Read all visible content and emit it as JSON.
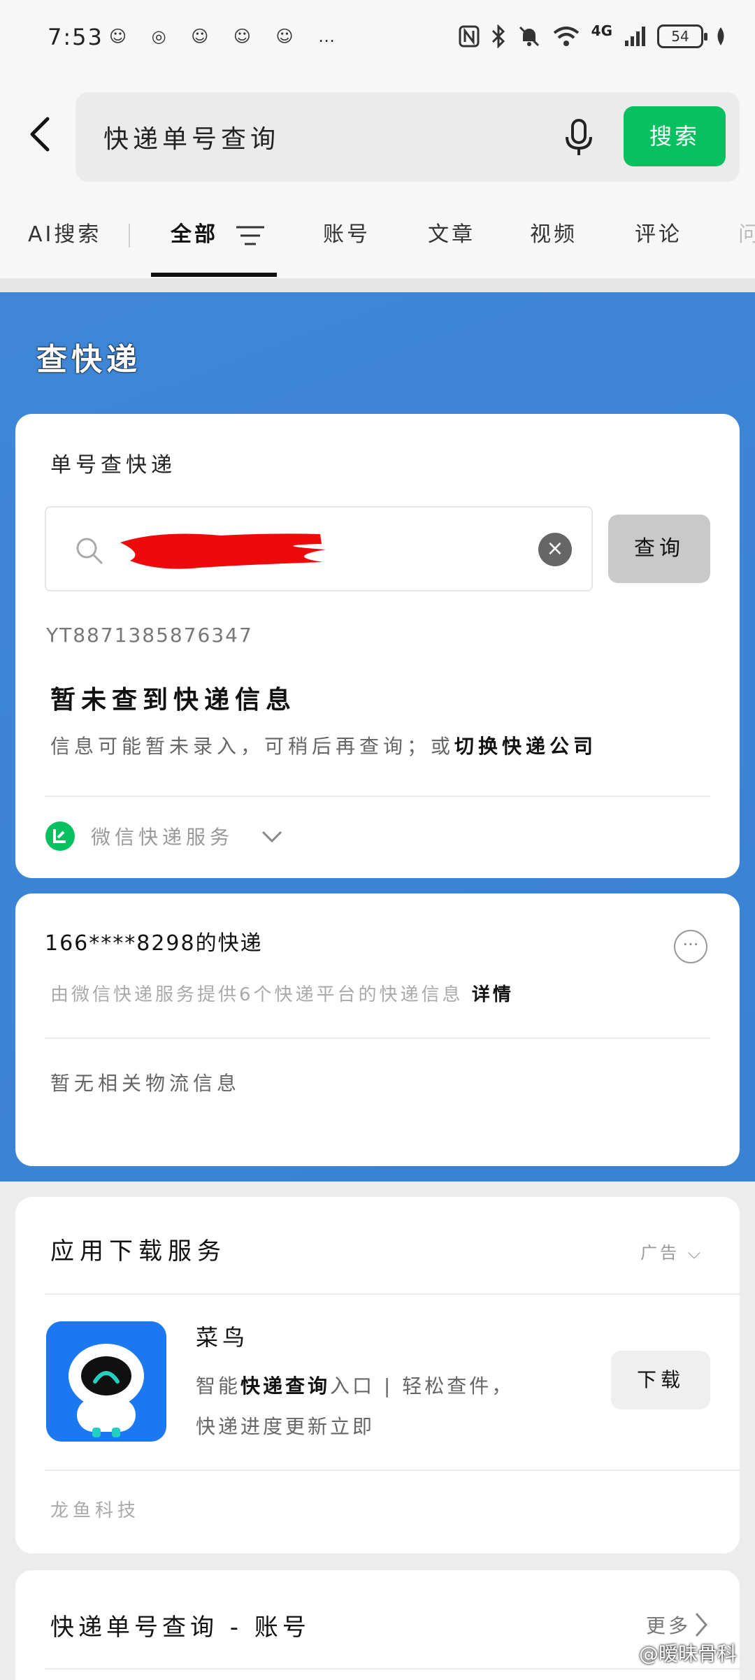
{
  "status": {
    "time": "7:53",
    "notification_icons": "☺ ◎ ☺ ☺ ☺ …",
    "network": "4G",
    "battery": "54"
  },
  "search": {
    "query": "快递单号查询",
    "button_label": "搜索"
  },
  "tabs": [
    {
      "label": "AI搜索"
    },
    {
      "label": "全部",
      "active": true
    },
    {
      "label": "账号"
    },
    {
      "label": "文章"
    },
    {
      "label": "视频"
    },
    {
      "label": "评论"
    },
    {
      "label": "问"
    }
  ],
  "express_panel": {
    "title": "查快递",
    "query_card": {
      "label": "单号查快递",
      "input_icon": "search-icon",
      "query_button": "查询",
      "tracking_number": "YT8871385876347",
      "not_found": "暂未查到快递信息",
      "hint_prefix": "信息可能暂未录入，可稍后再查询；或",
      "hint_link": "切换快递公司",
      "service_label": "微信快递服务"
    },
    "phone_card": {
      "title": "166****8298的快递",
      "subtitle": "由微信快递服务提供6个快递平台的快递信息",
      "detail_link": "详情",
      "empty_text": "暂无相关物流信息"
    }
  },
  "ad_card": {
    "title": "应用下载服务",
    "ad_tag": "广告",
    "app_name": "菜鸟",
    "desc_prefix": "智能",
    "desc_bold": "快递查询",
    "desc_suffix": "入口 | 轻松查件，",
    "desc_line2": "快递进度更新立即",
    "download_label": "下载",
    "company": "龙鱼科技"
  },
  "accounts_card": {
    "title": "快递单号查询 - 账号",
    "more_label": "更多"
  },
  "watermark": "@暧昧骨科",
  "colors": {
    "accent_green": "#07c160",
    "panel_blue": "#3f86d6"
  }
}
